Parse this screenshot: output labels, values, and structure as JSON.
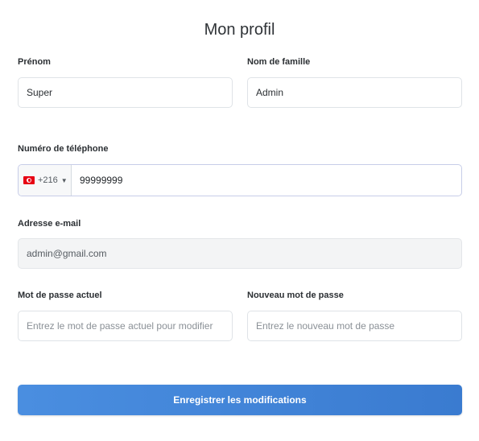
{
  "page": {
    "title": "Mon profil"
  },
  "form": {
    "first_name": {
      "label": "Prénom",
      "value": "Super"
    },
    "last_name": {
      "label": "Nom de famille",
      "value": "Admin"
    },
    "phone": {
      "label": "Numéro de téléphone",
      "country_code": "+216",
      "country_flag": "tunisia-flag-icon",
      "value": "99999999"
    },
    "email": {
      "label": "Adresse e-mail",
      "value": "admin@gmail.com"
    },
    "current_password": {
      "label": "Mot de passe actuel",
      "placeholder": "Entrez le mot de passe actuel pour modifier"
    },
    "new_password": {
      "label": "Nouveau mot de passe",
      "placeholder": "Entrez le nouveau mot de passe"
    },
    "submit_label": "Enregistrer les modifications"
  },
  "colors": {
    "button": "#3f84d8",
    "border": "#dfe3e7",
    "disabled_bg": "#f3f4f5"
  }
}
